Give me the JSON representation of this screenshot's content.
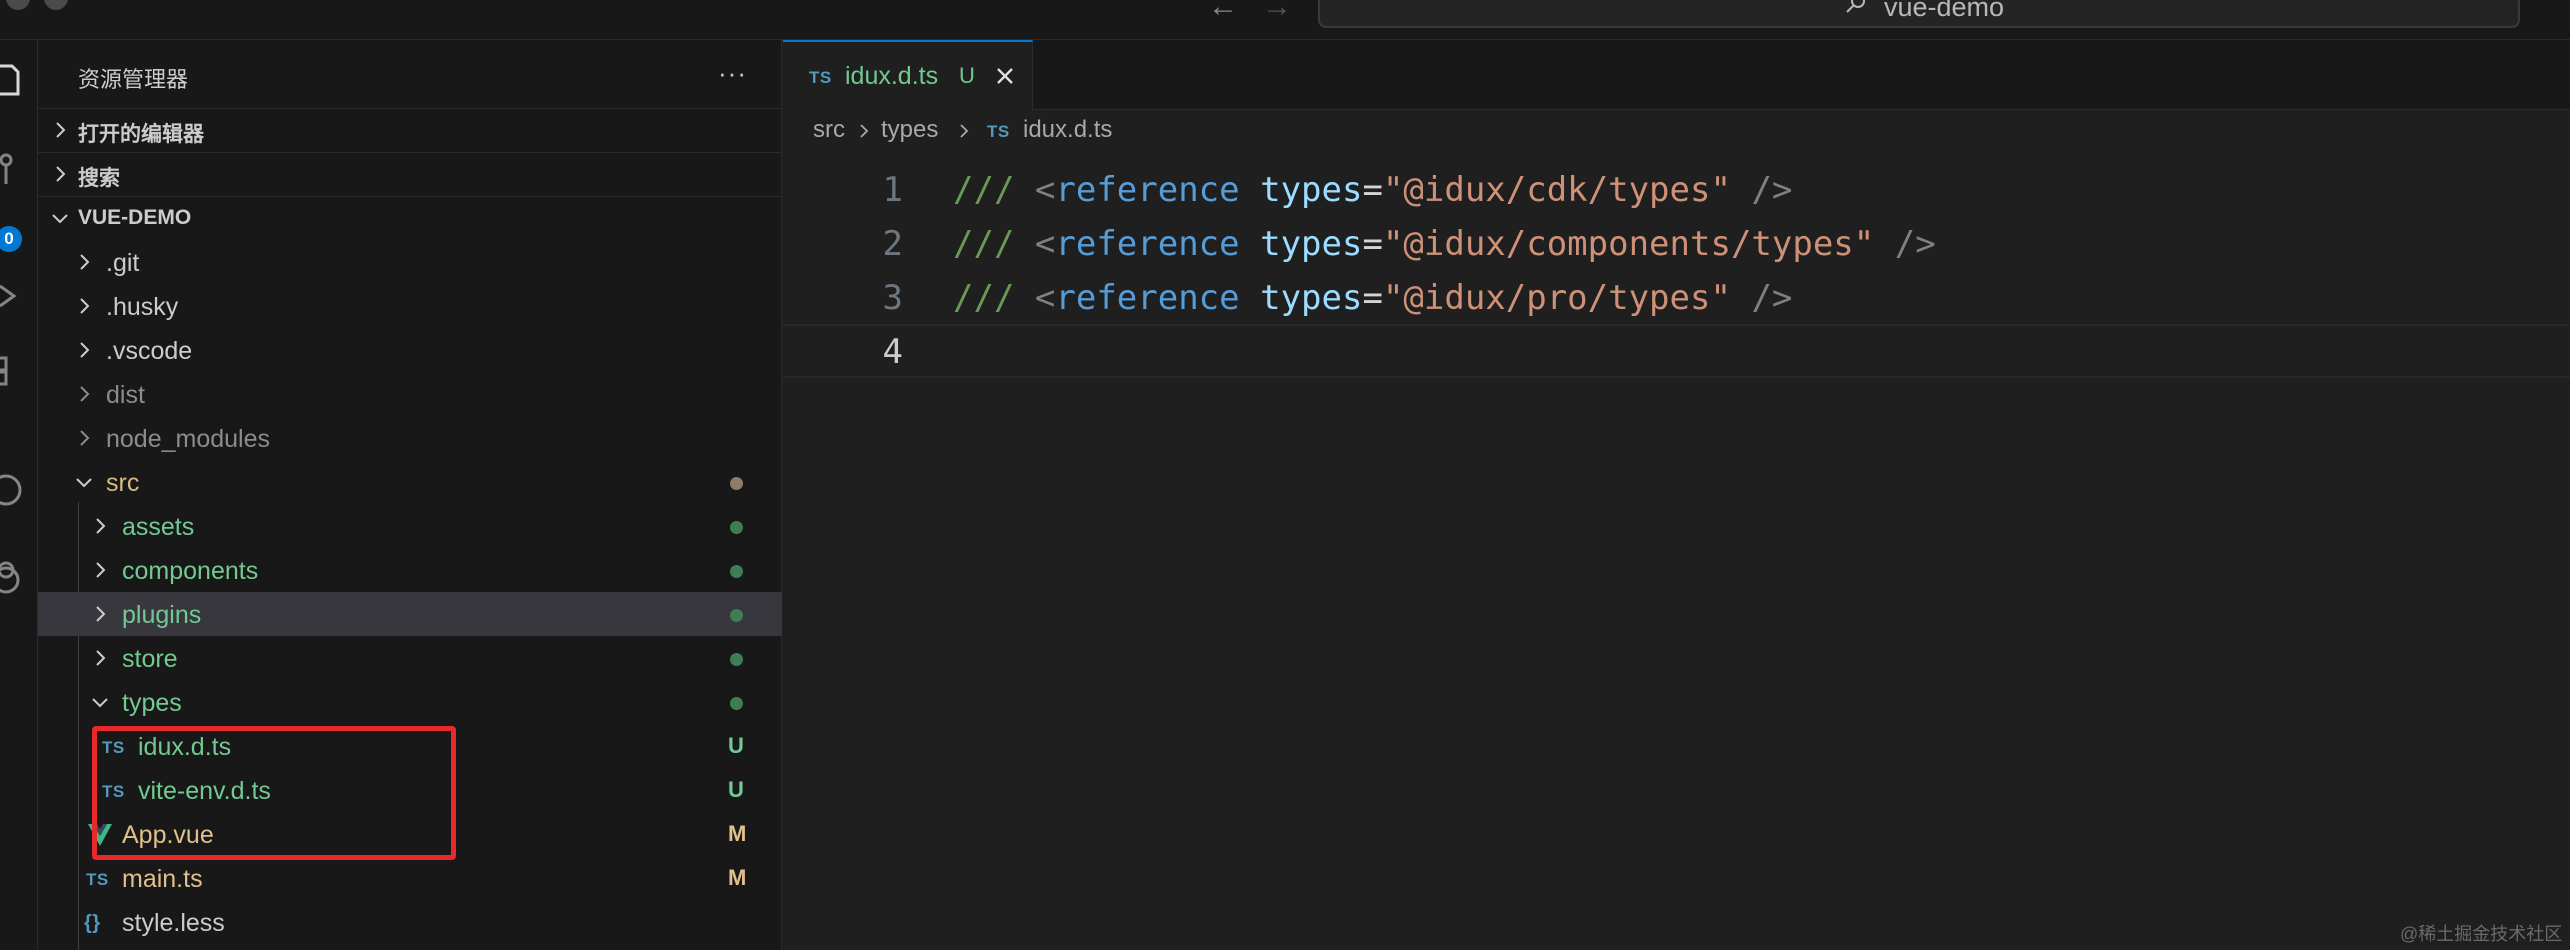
{
  "titlebar": {
    "search_text": "vue-demo"
  },
  "activity": {
    "badge_count": "0"
  },
  "sidebar": {
    "title": "资源管理器",
    "more": "···",
    "sections": {
      "open_editors": "打开的编辑器",
      "search": "搜索",
      "project": "VUE-DEMO"
    },
    "tree": [
      {
        "name": ".git",
        "status": ""
      },
      {
        "name": ".husky",
        "status": ""
      },
      {
        "name": ".vscode",
        "status": ""
      },
      {
        "name": "dist",
        "status": ""
      },
      {
        "name": "node_modules",
        "status": ""
      },
      {
        "name": "src",
        "status": ""
      },
      {
        "name": "assets",
        "status": ""
      },
      {
        "name": "components",
        "status": ""
      },
      {
        "name": "plugins",
        "status": ""
      },
      {
        "name": "store",
        "status": ""
      },
      {
        "name": "types",
        "status": ""
      },
      {
        "name": "idux.d.ts",
        "icon": "TS",
        "status": "U"
      },
      {
        "name": "vite-env.d.ts",
        "icon": "TS",
        "status": "U"
      },
      {
        "name": "App.vue",
        "status": "M"
      },
      {
        "name": "main.ts",
        "icon": "TS",
        "status": "M"
      },
      {
        "name": "style.less",
        "icon": "{}",
        "status": ""
      }
    ]
  },
  "editor": {
    "tab": {
      "icon": "TS",
      "name": "idux.d.ts",
      "status": "U"
    },
    "breadcrumb": [
      "src",
      "types",
      "idux.d.ts"
    ],
    "breadcrumb_icon": "TS",
    "lines": [
      {
        "number": "1",
        "prefix": "///",
        "open": "<",
        "tag": "reference",
        "attr": "types",
        "eq": "=",
        "value": "\"@idux/cdk/types\"",
        "close": "/>"
      },
      {
        "number": "2",
        "prefix": "///",
        "open": "<",
        "tag": "reference",
        "attr": "types",
        "eq": "=",
        "value": "\"@idux/components/types\"",
        "close": "/>"
      },
      {
        "number": "3",
        "prefix": "///",
        "open": "<",
        "tag": "reference",
        "attr": "types",
        "eq": "=",
        "value": "\"@idux/pro/types\"",
        "close": "/>"
      },
      {
        "number": "4"
      }
    ]
  },
  "watermark": "@稀土掘金技术社区",
  "colors": {
    "accent": "#0078d4",
    "untracked": "#73c991",
    "modified": "#e2c08d",
    "highlight": "#e8282a"
  }
}
